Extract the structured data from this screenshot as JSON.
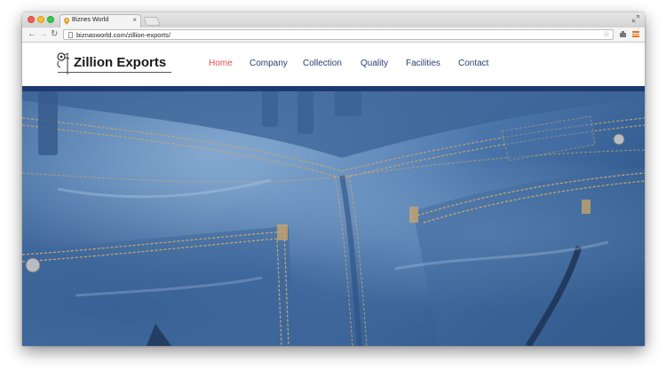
{
  "browser": {
    "tab_title": "Biznes World",
    "tab_close": "×",
    "url": "biznasworld.com/zillion-exports/",
    "star": "☆"
  },
  "site": {
    "logo_text": "Zillion Exports",
    "nav": [
      {
        "label": "Home",
        "active": true
      },
      {
        "label": "Company",
        "active": false
      },
      {
        "label": "Collection",
        "active": false
      },
      {
        "label": "Quality",
        "active": false
      },
      {
        "label": "Facilities",
        "active": false
      },
      {
        "label": "Contact",
        "active": false
      }
    ]
  },
  "colors": {
    "nav_active": "#e05050",
    "nav_text": "#2c3e70",
    "header_band": "#1d3a6e",
    "denim": "#4d78ad"
  },
  "icons": {
    "back": "back-arrow-icon",
    "forward": "forward-arrow-icon",
    "reload": "reload-icon",
    "star": "bookmark-star-icon",
    "menu": "hamburger-menu-icon"
  }
}
